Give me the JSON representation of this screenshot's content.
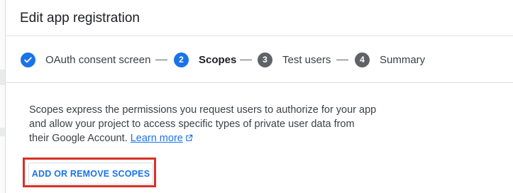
{
  "dialog": {
    "title": "Edit app registration"
  },
  "stepper": {
    "steps": [
      {
        "number": "",
        "label": "OAuth consent screen",
        "state": "done"
      },
      {
        "number": "2",
        "label": "Scopes",
        "state": "active"
      },
      {
        "number": "3",
        "label": "Test users",
        "state": "pending"
      },
      {
        "number": "4",
        "label": "Summary",
        "state": "pending"
      }
    ]
  },
  "scopes": {
    "description": "Scopes express the permissions you request users to authorize for your app and allow your project to access specific types of private user data from their Google Account.",
    "learn_more": "Learn more",
    "add_button": "ADD OR REMOVE SCOPES"
  },
  "colors": {
    "accent": "#1a73e8",
    "pending_step": "#5f6368",
    "highlight": "#d93025"
  },
  "icons": {
    "completed_step": "check-icon",
    "learn_more": "open-in-new-icon"
  }
}
